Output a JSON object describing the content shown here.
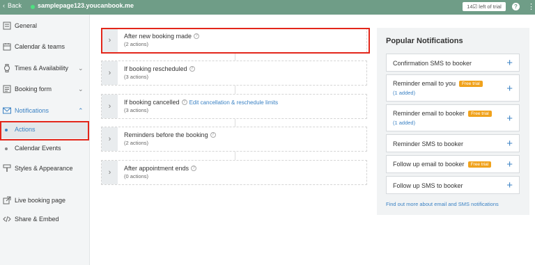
{
  "topbar": {
    "back_label": "Back",
    "site": "samplepage123.youcanbook.me",
    "trial_label": "14☑ left of trial",
    "help": "?"
  },
  "sidebar": {
    "items": [
      {
        "label": "General",
        "icon": "general-icon"
      },
      {
        "label": "Calendar & teams",
        "icon": "calendar-icon"
      },
      {
        "label": "Times & Availability",
        "icon": "watch-icon"
      },
      {
        "label": "Booking form",
        "icon": "form-icon"
      },
      {
        "label": "Notifications",
        "icon": "mail-icon"
      },
      {
        "label": "Actions"
      },
      {
        "label": "Calendar Events"
      },
      {
        "label": "Styles & Appearance",
        "icon": "brush-icon"
      },
      {
        "label": "Live booking page",
        "icon": "external-link-icon"
      },
      {
        "label": "Share & Embed",
        "icon": "code-icon"
      }
    ]
  },
  "cards": [
    {
      "title": "After new booking made",
      "sub": "(2 actions)"
    },
    {
      "title": "If booking rescheduled",
      "sub": "(3 actions)"
    },
    {
      "title": "If booking cancelled",
      "sub": "(3 actions)",
      "link": "Edit cancellation & reschedule limits"
    },
    {
      "title": "Reminders before the booking",
      "sub": "(2 actions)"
    },
    {
      "title": "After appointment ends",
      "sub": "(0 actions)"
    }
  ],
  "popular": {
    "title": "Popular Notifications",
    "items": [
      {
        "label": "Confirmation SMS to booker"
      },
      {
        "label": "Reminder email to you",
        "badge": "Free trial",
        "added": "(1 added)"
      },
      {
        "label": "Reminder email to booker",
        "badge": "Free trial",
        "added": "(1 added)"
      },
      {
        "label": "Reminder SMS to booker"
      },
      {
        "label": "Follow up email to booker",
        "badge": "Free trial"
      },
      {
        "label": "Follow up SMS to booker"
      }
    ],
    "footer_link": "Find out more about email and SMS notifications"
  },
  "colors": {
    "topbar": "#6f9d87",
    "accent": "#3b82c4",
    "highlight": "#e3261a",
    "badge": "#f0a21c"
  }
}
